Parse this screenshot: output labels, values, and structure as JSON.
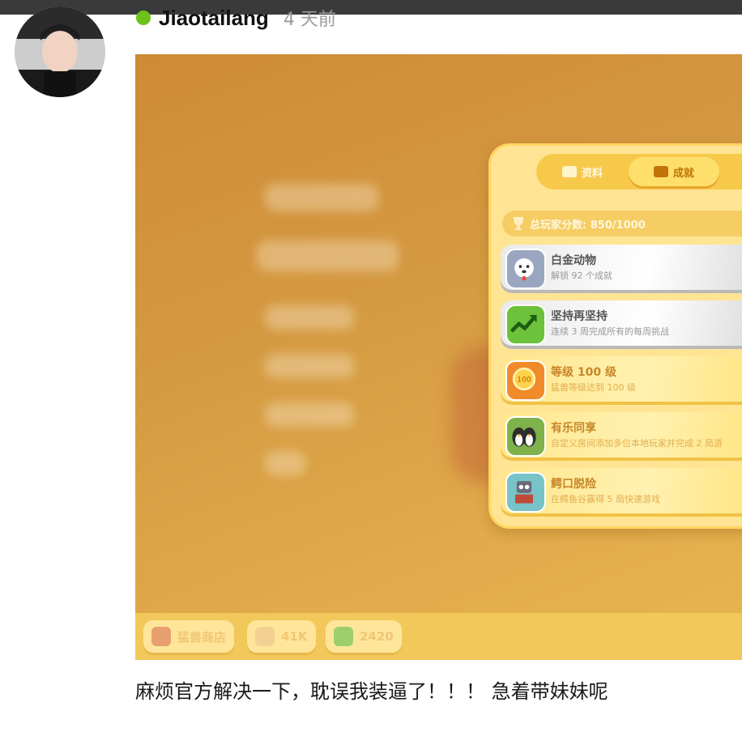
{
  "post": {
    "username": "Jiaotailang",
    "time": "4 天前",
    "comment": "麻烦官方解决一下，耽误我装逼了！！！ 急着带妹妹呢"
  },
  "game": {
    "tabs": [
      {
        "label": "资料",
        "active": false
      },
      {
        "label": "成就",
        "active": true
      }
    ],
    "score_label": "总玩家分数: 850/1000",
    "achievements": [
      {
        "title": "白金动物",
        "desc": "解锁 92 个成就",
        "style": "silver",
        "icon": "dog-badge-icon"
      },
      {
        "title": "坚持再坚持",
        "desc": "连续 3 周完成所有的每周挑战",
        "style": "silver",
        "icon": "trend-up-icon"
      },
      {
        "title": "等级 100 级",
        "desc": "猛兽等级达到 100 级",
        "style": "gold",
        "icon": "level-100-icon"
      },
      {
        "title": "有乐同享",
        "desc": "自定义房间添加多位本地玩家并完成 2 局游",
        "style": "gold",
        "icon": "penguins-icon"
      },
      {
        "title": "鳄口脱险",
        "desc": "在鳄鱼谷赢得 5 局快速游戏",
        "style": "gold",
        "icon": "robot-icon"
      }
    ],
    "bottom": {
      "shop_label": "猛兽商店",
      "bones": "41K",
      "cash": "2420"
    }
  },
  "colors": {
    "online": "#6cc21a",
    "game_bg": "#d49a41",
    "panel": "#ffe493"
  }
}
